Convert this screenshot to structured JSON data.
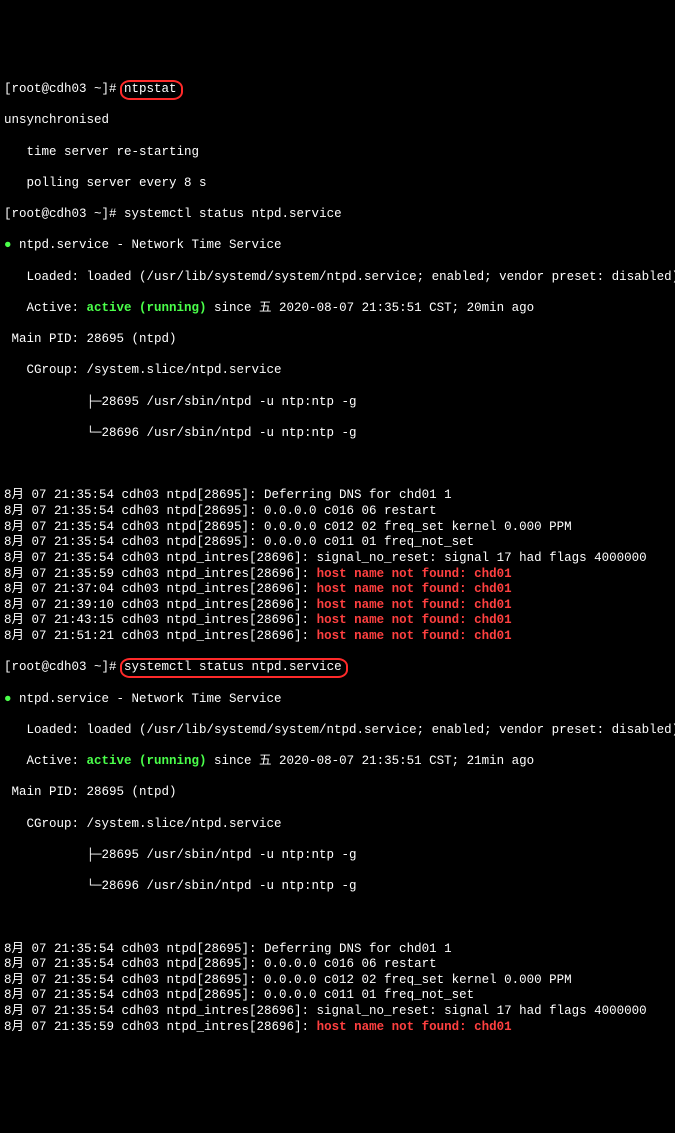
{
  "prompt1": "[root@cdh03 ~]# ",
  "cmd1": "ntpstat",
  "ntpstat": {
    "l1": "unsynchronised",
    "l2": "   time server re-starting",
    "l3": "   polling server every 8 s"
  },
  "prompt2": "[root@cdh03 ~]# ",
  "cmd2": "systemctl status ntpd.service",
  "svc1": {
    "bullet": "● ",
    "title": "ntpd.service - Network Time Service",
    "loaded": "   Loaded: loaded (/usr/lib/systemd/system/ntpd.service; enabled; vendor preset: disabled)",
    "active_prefix": "   Active: ",
    "active_state": "active (running)",
    "active_suffix": " since 五 2020-08-07 21:35:51 CST; 20min ago",
    "mainpid": " Main PID: 28695 (ntpd)",
    "cgroup": "   CGroup: /system.slice/ntpd.service",
    "tree1": "           ├─28695 /usr/sbin/ntpd -u ntp:ntp -g",
    "tree2": "           └─28696 /usr/sbin/ntpd -u ntp:ntp -g"
  },
  "log1": [
    {
      "t": "8月 07 21:35:54 cdh03 ntpd[28695]: Deferring DNS for chd01 1"
    },
    {
      "t": "8月 07 21:35:54 cdh03 ntpd[28695]: 0.0.0.0 c016 06 restart"
    },
    {
      "t": "8月 07 21:35:54 cdh03 ntpd[28695]: 0.0.0.0 c012 02 freq_set kernel 0.000 PPM"
    },
    {
      "t": "8月 07 21:35:54 cdh03 ntpd[28695]: 0.0.0.0 c011 01 freq_not_set"
    },
    {
      "t": "8月 07 21:35:54 cdh03 ntpd_intres[28696]: signal_no_reset: signal 17 had flags 4000000"
    },
    {
      "p": "8月 07 21:35:59 cdh03 ntpd_intres[28696]: ",
      "r": "host name not found: chd01"
    },
    {
      "p": "8月 07 21:37:04 cdh03 ntpd_intres[28696]: ",
      "r": "host name not found: chd01"
    },
    {
      "p": "8月 07 21:39:10 cdh03 ntpd_intres[28696]: ",
      "r": "host name not found: chd01"
    },
    {
      "p": "8月 07 21:43:15 cdh03 ntpd_intres[28696]: ",
      "r": "host name not found: chd01"
    },
    {
      "p": "8月 07 21:51:21 cdh03 ntpd_intres[28696]: ",
      "r": "host name not found: chd01"
    }
  ],
  "prompt3": "[root@cdh03 ~]# ",
  "cmd3": "systemctl status ntpd.service",
  "svc2": {
    "bullet": "● ",
    "title": "ntpd.service - Network Time Service",
    "loaded": "   Loaded: loaded (/usr/lib/systemd/system/ntpd.service; enabled; vendor preset: disabled)",
    "active_prefix": "   Active: ",
    "active_state": "active (running)",
    "active_suffix": " since 五 2020-08-07 21:35:51 CST; 21min ago",
    "mainpid": " Main PID: 28695 (ntpd)",
    "cgroup": "   CGroup: /system.slice/ntpd.service",
    "tree1": "           ├─28695 /usr/sbin/ntpd -u ntp:ntp -g",
    "tree2": "           └─28696 /usr/sbin/ntpd -u ntp:ntp -g"
  },
  "log2": [
    {
      "t": "8月 07 21:35:54 cdh03 ntpd[28695]: Deferring DNS for chd01 1"
    },
    {
      "t": "8月 07 21:35:54 cdh03 ntpd[28695]: 0.0.0.0 c016 06 restart"
    },
    {
      "t": "8月 07 21:35:54 cdh03 ntpd[28695]: 0.0.0.0 c012 02 freq_set kernel 0.000 PPM"
    },
    {
      "t": "8月 07 21:35:54 cdh03 ntpd[28695]: 0.0.0.0 c011 01 freq_not_set"
    },
    {
      "t": "8月 07 21:35:54 cdh03 ntpd_intres[28696]: signal_no_reset: signal 17 had flags 4000000"
    },
    {
      "p": "8月 07 21:35:59 cdh03 ntpd_intres[28696]: ",
      "r": "host name not found: chd01"
    }
  ]
}
